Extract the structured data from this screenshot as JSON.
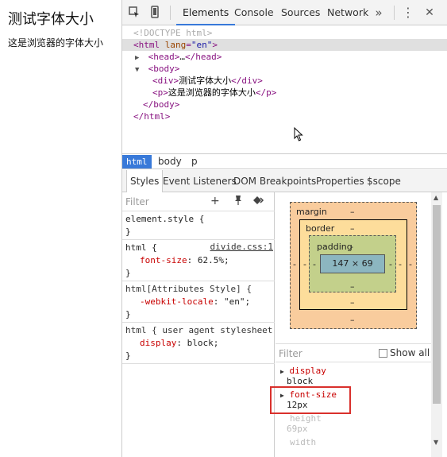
{
  "preview": {
    "heading": "测试字体大小",
    "paragraph": "这是浏览器的字体大小"
  },
  "toolbar": {
    "tabs": [
      {
        "label": "Elements"
      },
      {
        "label": "Console"
      },
      {
        "label": "Sources"
      },
      {
        "label": "Network"
      }
    ],
    "more": "»",
    "kebab": "⋮",
    "close": "✕"
  },
  "tree": {
    "doctype": "<!DOCTYPE html>",
    "html_open_tag": "html",
    "html_attr_name": "lang",
    "html_attr_value": "\"en\"",
    "head_collapsed": "head",
    "head_ellipsis": "…",
    "body_tag": "body",
    "div_tag": "div",
    "div_text": "测试字体大小",
    "p_tag": "p",
    "p_text": "这是浏览器的字体大小",
    "body_close": "</body>",
    "html_close": "</html>"
  },
  "breadcrumbs": [
    "html",
    "body",
    "p"
  ],
  "subtabs": [
    "Styles",
    "Event Listeners",
    "DOM Breakpoints",
    "Properties",
    "$scope"
  ],
  "styles": {
    "filter_placeholder": "Filter",
    "rules": [
      {
        "selector": "element.style {",
        "props": [],
        "close": "}"
      },
      {
        "selector": "html {",
        "source": "divide.css:1",
        "props": [
          {
            "name": "font-size",
            "value": "62.5%;"
          }
        ],
        "close": "}"
      },
      {
        "selector": "html[Attributes Style] {",
        "props": [
          {
            "name": "-webkit-locale",
            "value": "\"en\";"
          }
        ],
        "close": "}"
      },
      {
        "selector": "html { user agent stylesheet",
        "props": [
          {
            "name": "display",
            "value": "block;"
          }
        ],
        "close": "}"
      }
    ]
  },
  "box_model": {
    "margin_label": "margin",
    "border_label": "border",
    "padding_label": "padding",
    "padding_dash": "-",
    "content": "147 × 69",
    "dash": "–",
    "side_dash": "-"
  },
  "computed": {
    "filter_placeholder": "Filter",
    "show_all": "Show all",
    "props": [
      {
        "name": "display",
        "value": "block"
      },
      {
        "name": "font-size",
        "value": "12px"
      },
      {
        "name": "height",
        "value": "69px"
      },
      {
        "name": "width",
        "value": ""
      }
    ]
  },
  "colors": {
    "accent": "#3879d9",
    "highlight": "#d9302c"
  }
}
